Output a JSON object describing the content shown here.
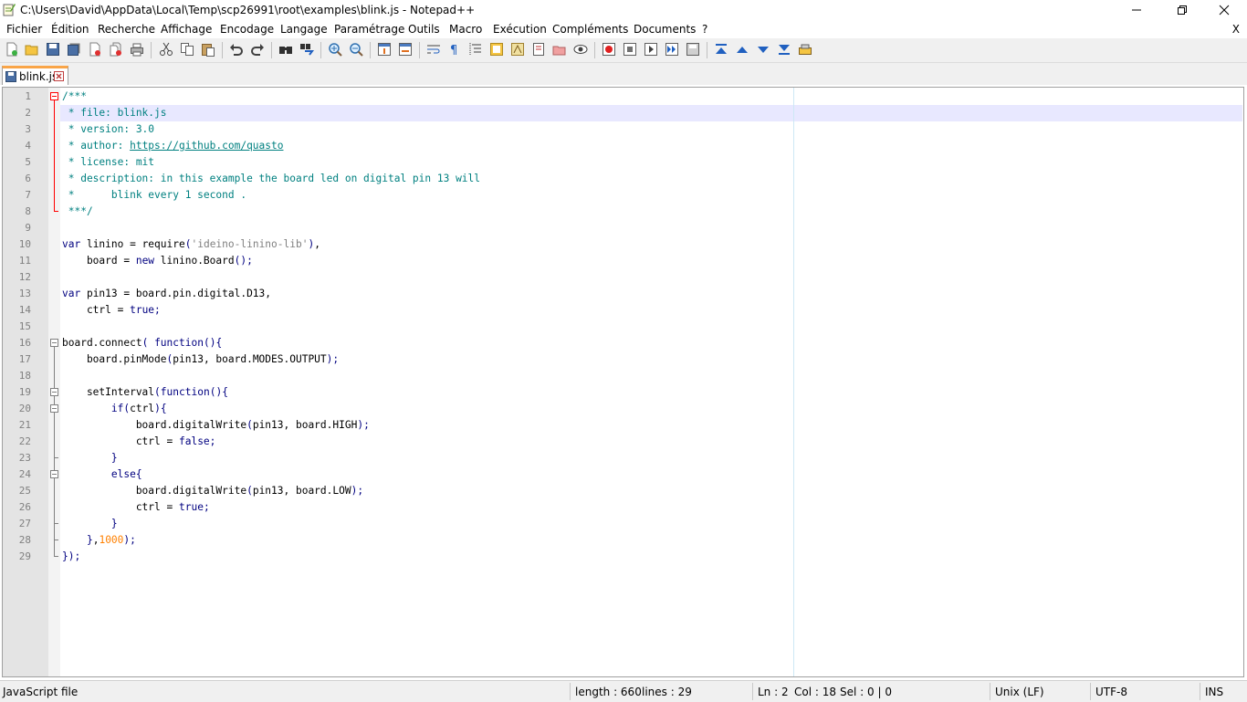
{
  "window": {
    "title": "C:\\Users\\David\\AppData\\Local\\Temp\\scp26991\\root\\examples\\blink.js - Notepad++"
  },
  "menu": {
    "items": [
      "Fichier",
      "Édition",
      "Recherche",
      "Affichage",
      "Encodage",
      "Langage",
      "Paramétrage",
      "Outils",
      "Macro",
      "Exécution",
      "Compléments",
      "Documents",
      "?"
    ],
    "close_label": "X"
  },
  "toolbar": {
    "icons": [
      "new-file-icon",
      "open-file-icon",
      "save-icon",
      "save-all-icon",
      "close-icon",
      "close-all-icon",
      "print-icon",
      "cut-icon",
      "copy-icon",
      "paste-icon",
      "undo-icon",
      "redo-icon",
      "find-icon",
      "replace-icon",
      "zoom-in-icon",
      "zoom-out-icon",
      "sync-vertical-icon",
      "sync-horizontal-icon",
      "word-wrap-icon",
      "show-all-chars-icon",
      "indent-guide-icon",
      "function-list-icon",
      "folder-as-workspace-icon",
      "document-map-icon",
      "doc-list-icon",
      "monitoring-icon",
      "record-macro-icon",
      "stop-record-icon",
      "play-macro-icon",
      "run-macro-multiple-icon",
      "save-macro-icon",
      "move-to-top-icon",
      "move-up-icon",
      "move-down-icon",
      "move-to-bottom-icon",
      "plugin-icon"
    ]
  },
  "tabs": [
    {
      "label": "blink.js",
      "active": true
    }
  ],
  "editor": {
    "language": "javascript",
    "current_line": 2,
    "lines": [
      "/***",
      " * file: blink.js",
      " * version: 3.0",
      " * author: https://github.com/quasto",
      " * license: mit",
      " * description: in this example the board led on digital pin 13 will",
      " *      blink every 1 second .",
      " ***/",
      "",
      "var linino = require('ideino-linino-lib'),",
      "    board = new linino.Board();",
      "",
      "var pin13 = board.pin.digital.D13,",
      "    ctrl = true;",
      "",
      "board.connect( function(){",
      "    board.pinMode(pin13, board.MODES.OUTPUT);",
      "",
      "    setInterval(function(){",
      "        if(ctrl){",
      "            board.digitalWrite(pin13, board.HIGH);",
      "            ctrl = false;",
      "        }",
      "        else{",
      "            board.digitalWrite(pin13, board.LOW);",
      "            ctrl = true;",
      "        }",
      "    },1000);",
      "});"
    ]
  },
  "status": {
    "file_type": "JavaScript file",
    "length": "length : 660",
    "lines": "lines : 29",
    "ln": "Ln : 2",
    "col": "Col : 18",
    "sel": "Sel : 0 | 0",
    "eol": "Unix (LF)",
    "encoding": "UTF-8",
    "mode": "INS"
  },
  "colors": {
    "comment": "#008080",
    "keyword": "#000080",
    "string": "#808080",
    "number": "#ff8000",
    "current_line": "#e8e8ff",
    "tab_accent": "#f9a548"
  }
}
